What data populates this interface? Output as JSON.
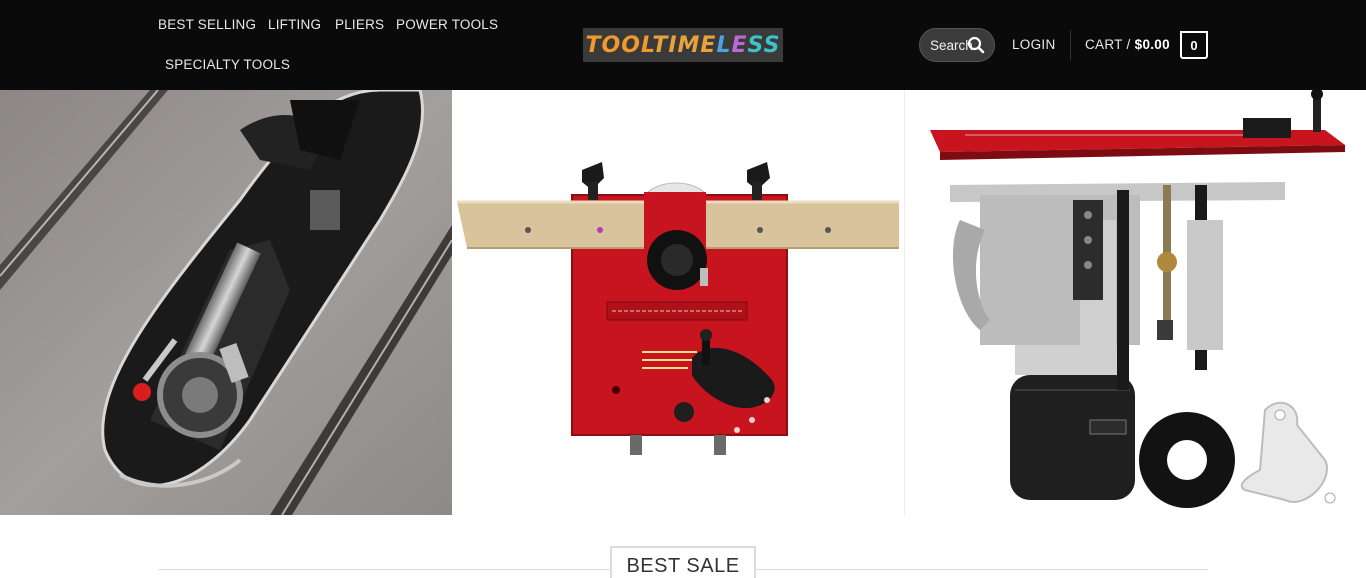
{
  "header": {
    "nav": [
      {
        "label": "BEST SELLING"
      },
      {
        "label": "LIFTING"
      },
      {
        "label": "PLIERS"
      },
      {
        "label": "POWER TOOLS"
      },
      {
        "label": "SPECIALTY TOOLS"
      }
    ],
    "logo": {
      "parts": [
        "TOOL",
        "TIME",
        "L",
        "E",
        "SS"
      ]
    },
    "search": {
      "label": "Search",
      "icon": "search-icon"
    },
    "login_label": "LOGIN",
    "cart": {
      "label": "CART /",
      "amount": "$0.00",
      "count": "0"
    }
  },
  "banner": {
    "panels": [
      "table-saw-closeup",
      "router-table-fence",
      "router-lift-plate"
    ]
  },
  "section": {
    "title": "BEST SALE"
  },
  "colors": {
    "header_bg": "#0a0a0a",
    "plate_red": "#c8141e",
    "text_light": "#e8e8e8"
  }
}
